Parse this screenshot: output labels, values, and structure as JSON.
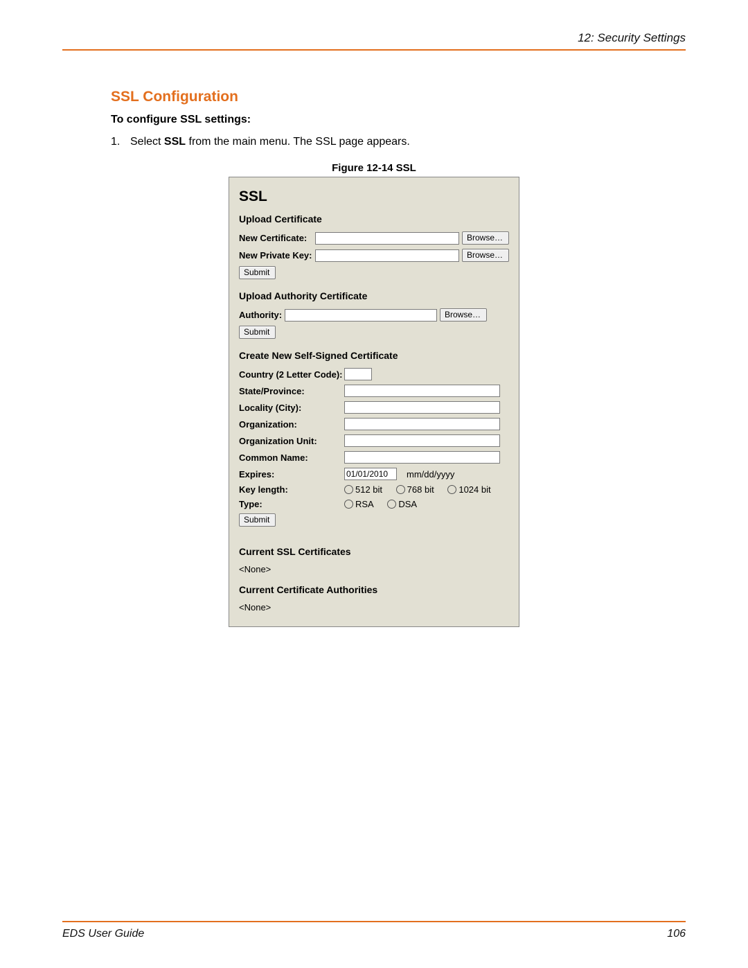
{
  "header": {
    "chapter": "12: Security Settings"
  },
  "section": {
    "title": "SSL Configuration",
    "instruction_lead": "To configure SSL settings:",
    "step_num": "1.",
    "step_text_pre": "Select ",
    "step_text_bold": "SSL",
    "step_text_post": " from the main menu. The SSL page appears."
  },
  "figure": {
    "caption": "Figure 12-14  SSL",
    "panel_title": "SSL",
    "upload_cert": {
      "heading": "Upload Certificate",
      "new_cert_label": "New Certificate:",
      "new_key_label": "New Private Key:",
      "browse": "Browse…",
      "submit": "Submit"
    },
    "upload_auth": {
      "heading": "Upload Authority Certificate",
      "authority_label": "Authority:",
      "browse": "Browse…",
      "submit": "Submit"
    },
    "create": {
      "heading": "Create New Self-Signed Certificate",
      "country_label": "Country (2 Letter Code):",
      "state_label": "State/Province:",
      "locality_label": "Locality (City):",
      "org_label": "Organization:",
      "ou_label": "Organization Unit:",
      "cn_label": "Common Name:",
      "expires_label": "Expires:",
      "expires_value": "01/01/2010",
      "expires_hint": "mm/dd/yyyy",
      "keylen_label": "Key length:",
      "keylen_options": [
        "512 bit",
        "768 bit",
        "1024 bit"
      ],
      "type_label": "Type:",
      "type_options": [
        "RSA",
        "DSA"
      ],
      "submit": "Submit"
    },
    "current_certs": {
      "heading": "Current SSL Certificates",
      "value": "<None>"
    },
    "current_auths": {
      "heading": "Current Certificate Authorities",
      "value": "<None>"
    }
  },
  "footer": {
    "doc_title": "EDS User Guide",
    "page_num": "106"
  }
}
